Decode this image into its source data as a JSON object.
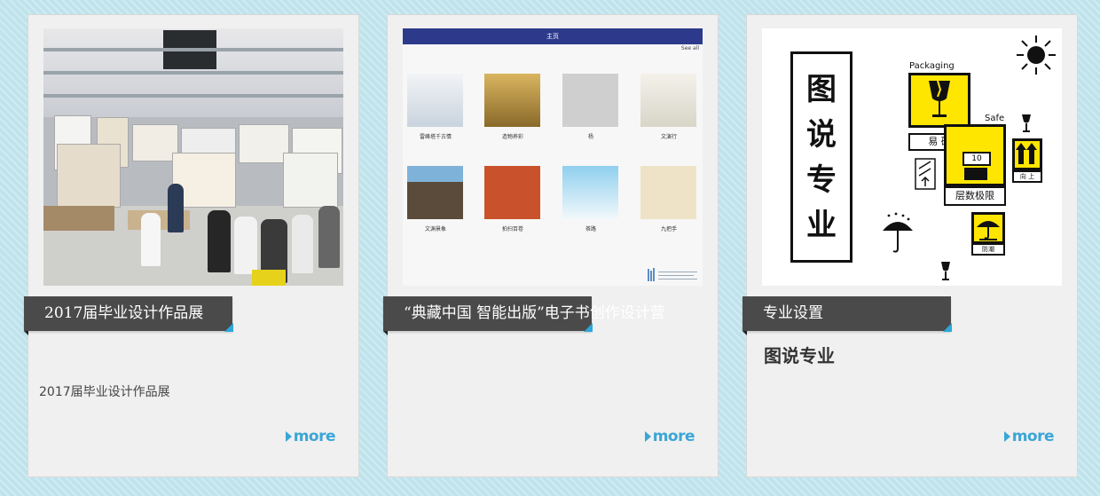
{
  "cards": [
    {
      "label": "2017届毕业设计作品展",
      "description": "2017届毕业设计作品展",
      "more": "more"
    },
    {
      "label": "“典藏中国 智能出版”电子书创作设计营",
      "more": "more",
      "app": {
        "title": "主页",
        "see_all": "See all",
        "tiles": [
          "雷峰塔千古情",
          "造物养彩",
          "杨",
          "文演行",
          "文渊景象",
          "拍扫百卷",
          "茶路",
          "九把手"
        ]
      }
    },
    {
      "label": "专业设置",
      "description": "图说专业",
      "more": "more",
      "diagram": {
        "vertical_text": [
          "图",
          "说",
          "专",
          "业"
        ],
        "packaging_label": "Packaging",
        "safe_label": "Safe",
        "fragile_tag": "易 碎",
        "stack_number": "10",
        "stack_tag": "层数极限",
        "up_tag": "向 上",
        "moisture_tag": "防潮"
      }
    }
  ],
  "colors": {
    "accent": "#3aa6d6",
    "label_bg": "#4a4a4a",
    "page_bg": "#bfe3ec"
  }
}
